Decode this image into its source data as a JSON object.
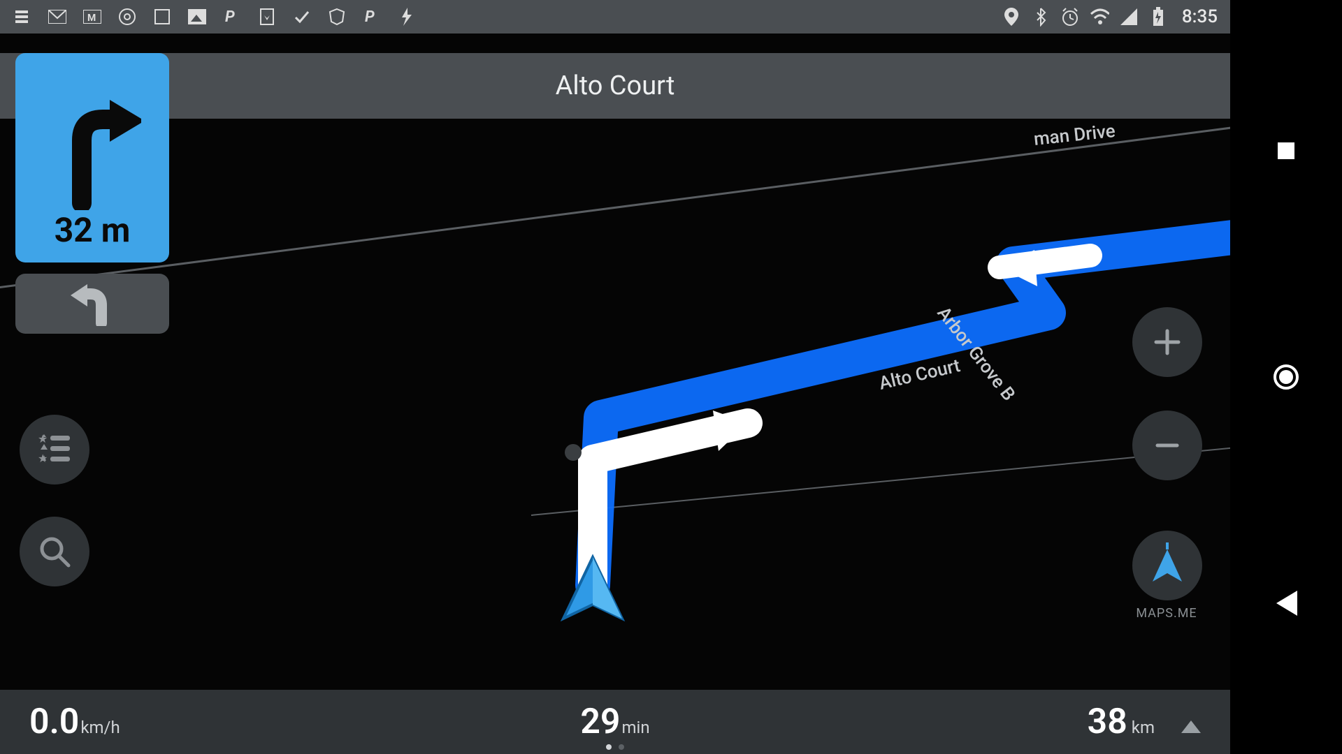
{
  "statusbar": {
    "clock": "8:35"
  },
  "street": {
    "name": "Alto Court"
  },
  "turn": {
    "distance": "32 m"
  },
  "map": {
    "labels": {
      "alto_court": "Alto Court",
      "arbor_grove": "Arbor Grove B",
      "man_drive": "man Drive"
    }
  },
  "controls": {
    "compass_label": "MAPS.ME"
  },
  "bottom": {
    "speed_value": "0.0",
    "speed_unit": "km/h",
    "eta_value": "29",
    "eta_unit": "min",
    "distance_value": "38",
    "distance_unit": "km"
  }
}
